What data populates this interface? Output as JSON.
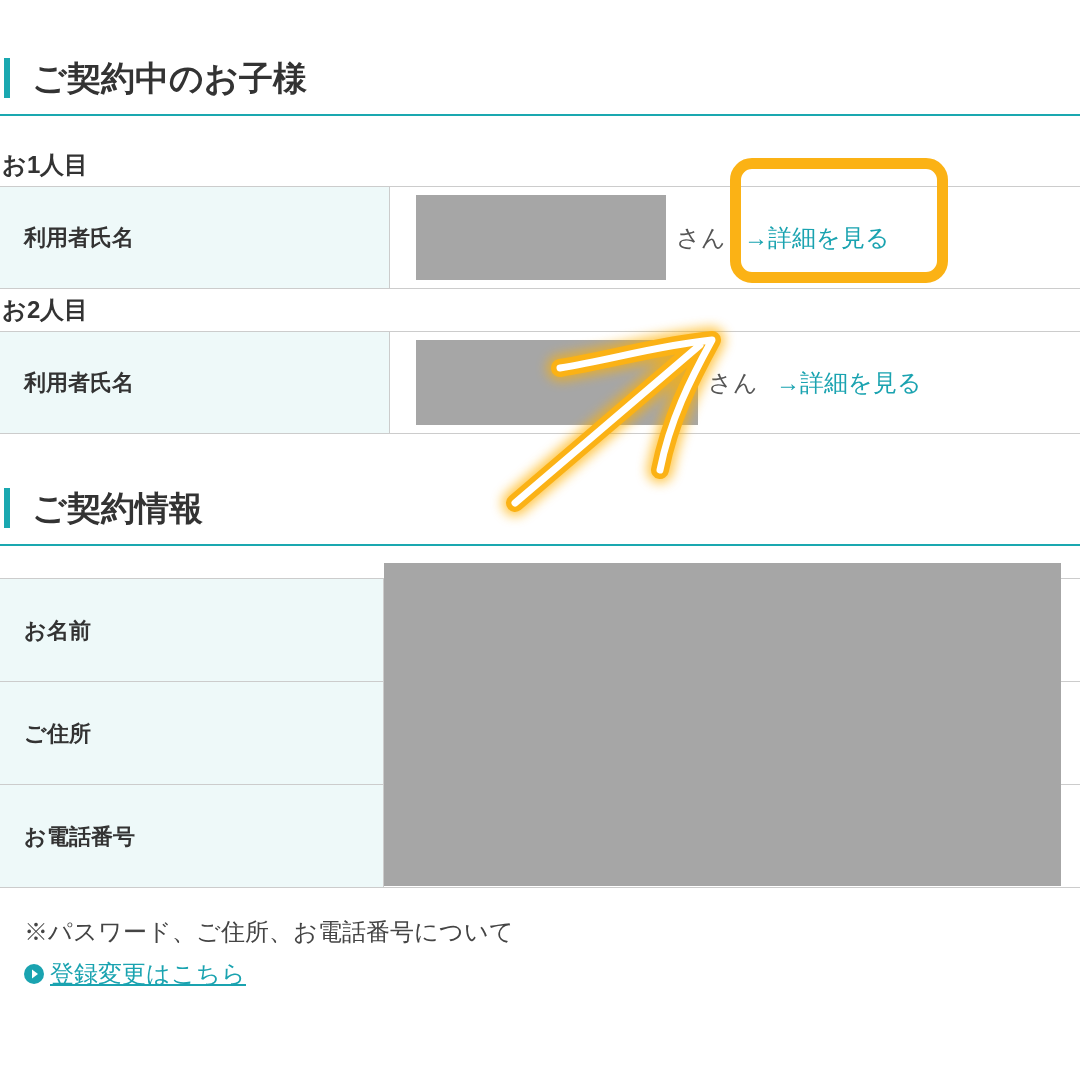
{
  "sections": [
    {
      "heading": "ご契約中のお子様",
      "children": [
        {
          "label": "お1人目",
          "rows": [
            {
              "field": "利用者氏名",
              "suffix": "さん",
              "link": "→詳細を見る",
              "highlighted": true
            }
          ]
        },
        {
          "label": "お2人目",
          "rows": [
            {
              "field": "利用者氏名",
              "suffix": "さん",
              "link": "→詳細を見る",
              "highlighted": false
            }
          ]
        }
      ]
    },
    {
      "heading": "ご契約情報",
      "rows": [
        {
          "field": "お名前"
        },
        {
          "field": "ご住所"
        },
        {
          "field": "お電話番号"
        }
      ]
    }
  ],
  "note": "※パスワード、ご住所、お電話番号について",
  "change_link": "登録変更はこちら"
}
